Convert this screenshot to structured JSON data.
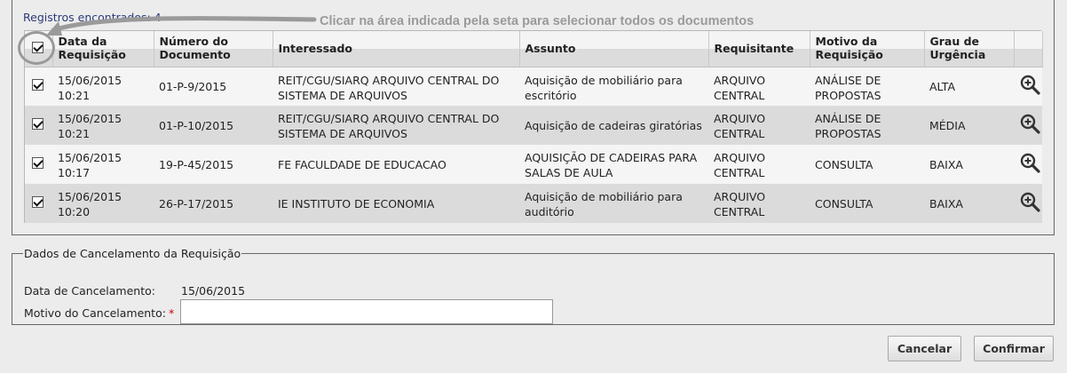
{
  "records_found": "Registros encontrados: 4",
  "annotation": "Clicar na área indicada pela seta para selecionar todos os documentos",
  "columns": [
    {
      "line1": "",
      "line2": ""
    },
    {
      "line1": "Data da",
      "line2": "Requisição"
    },
    {
      "line1": "Número do",
      "line2": "Documento"
    },
    {
      "line1": "Interessado",
      "line2": ""
    },
    {
      "line1": "Assunto",
      "line2": ""
    },
    {
      "line1": "Requisitante",
      "line2": ""
    },
    {
      "line1": "Motivo da",
      "line2": "Requisição"
    },
    {
      "line1": "Grau de",
      "line2": "Urgência"
    },
    {
      "line1": "",
      "line2": ""
    }
  ],
  "rows": [
    {
      "date": "15/06/2015",
      "time": "10:21",
      "doc": "01-P-9/2015",
      "interessado1": "REIT/CGU/SIARQ ARQUIVO CENTRAL DO",
      "interessado2": "SISTEMA DE ARQUIVOS",
      "assunto1": "Aquisição de mobiliário para",
      "assunto2": "escritório",
      "req1": "ARQUIVO",
      "req2": "CENTRAL",
      "motivo1": "ANÁLISE DE",
      "motivo2": "PROPOSTAS",
      "grau": "ALTA"
    },
    {
      "date": "15/06/2015",
      "time": "10:21",
      "doc": "01-P-10/2015",
      "interessado1": "REIT/CGU/SIARQ ARQUIVO CENTRAL DO",
      "interessado2": "SISTEMA DE ARQUIVOS",
      "assunto1": "Aquisição de cadeiras giratórias",
      "assunto2": "",
      "req1": "ARQUIVO",
      "req2": "CENTRAL",
      "motivo1": "ANÁLISE DE",
      "motivo2": "PROPOSTAS",
      "grau": "MÉDIA"
    },
    {
      "date": "15/06/2015",
      "time": "10:17",
      "doc": "19-P-45/2015",
      "interessado1": "FE FACULDADE DE EDUCACAO",
      "interessado2": "",
      "assunto1": "AQUISIÇÃO DE CADEIRAS PARA",
      "assunto2": "SALAS DE AULA",
      "req1": "ARQUIVO",
      "req2": "CENTRAL",
      "motivo1": "CONSULTA",
      "motivo2": "",
      "grau": "BAIXA"
    },
    {
      "date": "15/06/2015",
      "time": "10:20",
      "doc": "26-P-17/2015",
      "interessado1": "IE INSTITUTO DE ECONOMIA",
      "interessado2": "",
      "assunto1": "Aquisição de mobiliário para",
      "assunto2": "auditório",
      "req1": "ARQUIVO",
      "req2": "CENTRAL",
      "motivo1": "CONSULTA",
      "motivo2": "",
      "grau": "BAIXA"
    }
  ],
  "cancel_section": {
    "legend": "Dados de Cancelamento da Requisição",
    "date_label": "Data de Cancelamento:",
    "date_value": "15/06/2015",
    "reason_label": "Motivo do Cancelamento:",
    "required_mark": "*",
    "reason_value": ""
  },
  "buttons": {
    "cancel": "Cancelar",
    "confirm": "Confirmar"
  },
  "icons": {
    "select_all": "checkbox-icon",
    "row_check": "checkbox-icon",
    "detail": "zoom-in-icon"
  },
  "colors": {
    "annotation": "#9a9a9a",
    "row_alt": "#dcdbdc",
    "required": "#cc0000"
  }
}
